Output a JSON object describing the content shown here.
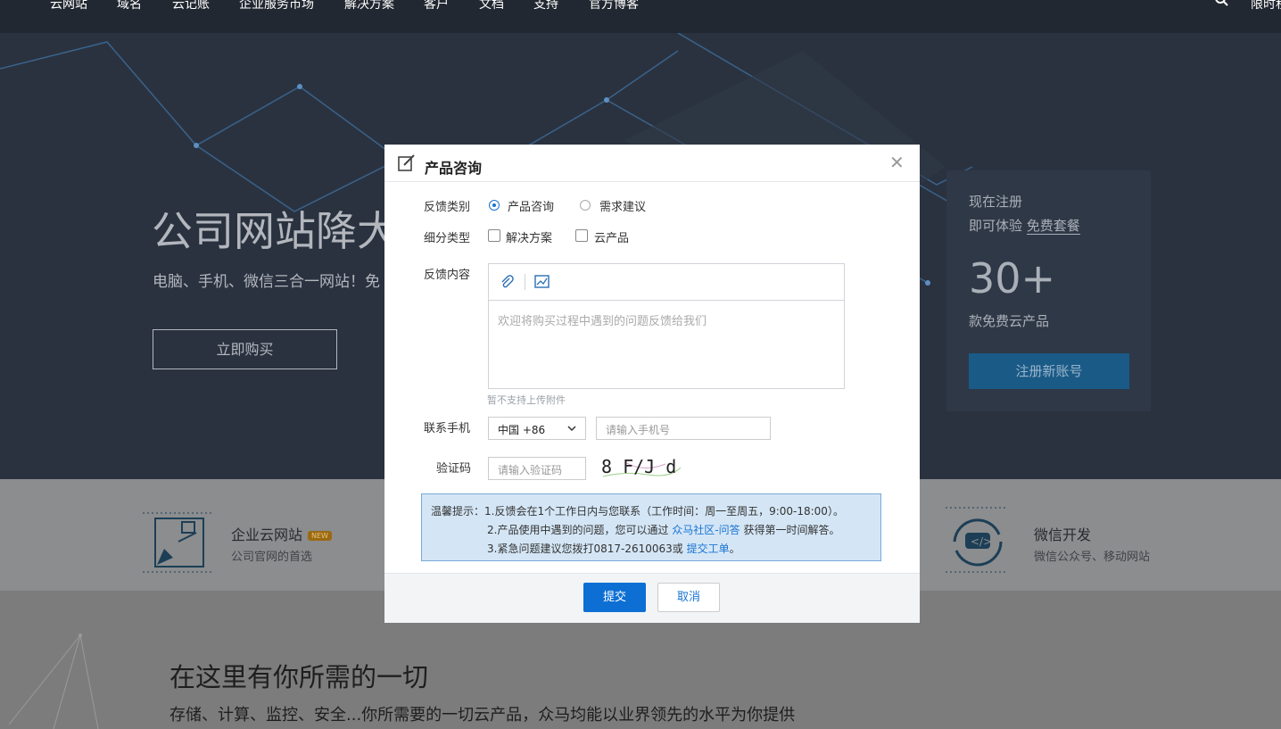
{
  "nav": {
    "items": [
      "云网站",
      "域名",
      "云记账",
      "企业服务市场",
      "解决方案",
      "客户",
      "文档",
      "支持",
      "官方博客"
    ],
    "right_label": "限时秒"
  },
  "hero": {
    "title": "公司网站降大",
    "subtitle": "电脑、手机、微信三合一网站！免",
    "buy_label": "立即购买"
  },
  "register_panel": {
    "line1": "现在注册",
    "line2_prefix": "即可体验",
    "line2_link": "免费套餐",
    "count": "30+",
    "line3": "款免费云产品",
    "button": "注册新账号"
  },
  "features": [
    {
      "title": "企业云网站",
      "badge": "NEW",
      "desc": "公司官网的首选"
    },
    {
      "title": "微信开发",
      "desc": "微信公众号、移动网站"
    }
  ],
  "lower": {
    "title": "在这里有你所需的一切",
    "subtitle": "存储、计算、监控、安全...你所需要的一切云产品，众马均能以业界领先的水平为你提供"
  },
  "modal": {
    "title": "产品咨询",
    "feedback_type_label": "反馈类别",
    "feedback_types": [
      {
        "label": "产品咨询",
        "selected": true
      },
      {
        "label": "需求建议",
        "selected": false
      }
    ],
    "subtype_label": "细分类型",
    "subtypes": [
      {
        "label": "解决方案",
        "checked": false
      },
      {
        "label": "云产品",
        "checked": false
      }
    ],
    "content_label": "反馈内容",
    "content_placeholder": "欢迎将购买过程中遇到的问题反馈给我们",
    "attachment_hint": "暂不支持上传附件",
    "phone_label": "联系手机",
    "country_code": "中国 +86",
    "phone_placeholder": "请输入手机号",
    "captcha_label": "验证码",
    "captcha_placeholder": "请输入验证码",
    "captcha_text": "8 F/J d",
    "notice": {
      "line1": "温馨提示：1.反馈会在1个工作日内与您联系（工作时间：周一至周五，9:00-18:00）。",
      "line2_prefix": "2.产品使用中遇到的问题，您可以通过",
      "line2_link": "众马社区-问答",
      "line2_suffix": "获得第一时间解答。",
      "line3_prefix": "3.紧急问题建议您拨打0817-2610063或",
      "line3_link": "提交工单",
      "line3_suffix": "。"
    },
    "submit_label": "提交",
    "cancel_label": "取消"
  },
  "colors": {
    "nav_bg": "#222831",
    "hero_bg": "#2a3240",
    "primary": "#0d6fd3",
    "notice_bg": "#d4e6f6",
    "link": "#1a74d1"
  },
  "icons": [
    "search-icon",
    "edit-icon",
    "close-icon",
    "paperclip-icon",
    "image-icon",
    "chevron-down-icon",
    "website-feature-icon",
    "wechat-dev-feature-icon"
  ]
}
